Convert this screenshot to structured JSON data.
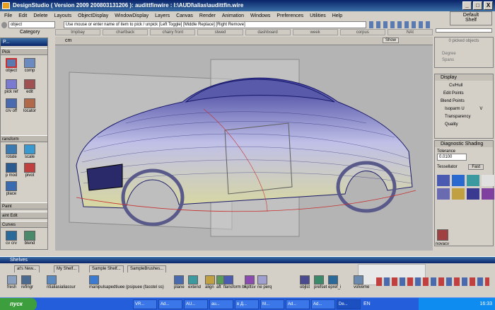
{
  "window": {
    "title": "DesignStudio ( Version 2009  200803131206 ): audittfinwire : I:\\AUDI\\alias\\audittfin.wire",
    "min": "_",
    "max": "□",
    "close": "X"
  },
  "menu": [
    "File",
    "Edit",
    "Delete",
    "Layouts",
    "ObjectDisplay",
    "WindowDisplay",
    "Layers",
    "Canvas",
    "Render",
    "Animation",
    "Windows",
    "Preferences",
    "Utilities",
    "Help"
  ],
  "toolbar": {
    "object_field": "object",
    "category_label": "Category",
    "prompt": "Use mouse or enter name of item to pick / unpick [Left Toggle] [Middle Replace] [Right Remove]"
  },
  "shelf_tabs_top": [
    "tmpbay",
    "chartback",
    "chairy front",
    "stwed",
    "dashboard",
    "week",
    "corpus",
    "NAt"
  ],
  "right_top": {
    "default": "Default",
    "shelf": "Shelf",
    "picked": "0 picked objects",
    "degree": "Degree",
    "spans": "Spans"
  },
  "viewbar": {
    "show": "Show",
    "view": "cm"
  },
  "palette": {
    "title": "P...",
    "pick_label": "Pick",
    "tools_pick": [
      {
        "icon": "object-pick-icon",
        "label": "object"
      },
      {
        "icon": "comp-pick-icon",
        "label": "comp"
      },
      {
        "icon": "pick-ref-icon",
        "label": "pick ref"
      },
      {
        "icon": "edit-icon",
        "label": "edit"
      },
      {
        "icon": "crv-off-icon",
        "label": "crv off"
      },
      {
        "icon": "locator-icon",
        "label": "locator"
      }
    ],
    "transform_label": "ransform",
    "tools_transform": [
      {
        "icon": "rotate-icon",
        "label": "rotate"
      },
      {
        "icon": "scale-icon",
        "label": "scale"
      },
      {
        "icon": "p-mod-icon",
        "label": "p mod"
      },
      {
        "icon": "pivot-icon",
        "label": "pivot"
      },
      {
        "icon": "place-icon",
        "label": "place"
      }
    ],
    "paint_label": "Paint",
    "paint_edit_label": "aint Edit",
    "curves_label": "Curves",
    "tools_curves": [
      {
        "icon": "cv-crv-icon",
        "label": "cv crv"
      },
      {
        "icon": "blend-icon",
        "label": "blend"
      }
    ]
  },
  "rpanel": {
    "display_title": "Display",
    "cvhull": "Cv/Hull",
    "edit_points": "Edit Points",
    "blend_points": "Blend Points",
    "isoparm": "Isoparm U",
    "isoparm_v": "V",
    "transparency": "Transparency",
    "quality": "Quality",
    "diag_title": "Diagnostic Shading",
    "tolerance": "Tolerance",
    "tolerance_value": "0.0100",
    "tessellator": "Tessellator",
    "tess_value": "Fast",
    "novacv": "novacv"
  },
  "shelves": {
    "title": "Shelves",
    "tabs": [
      "at's New...",
      "My Shelf...",
      "Sample Shelf...",
      "SampleBrushes..."
    ],
    "items": [
      "fresh",
      "refingr",
      "ntialiasialiassur",
      "manipulsapedtiuee (psipuee (fasstel ss)",
      "plane",
      "extend",
      "align",
      "aft",
      "flansform bl",
      "kpttsv",
      "ne perq",
      "objlst",
      "prefset",
      "epref_i",
      "volveme"
    ]
  },
  "taskbar": {
    "start": "пуск",
    "tasks": [
      "VR...",
      "Ad...",
      "AU...",
      "au...",
      "в Д...",
      "M...",
      "Ad...",
      "Ad...",
      "De..."
    ],
    "lang": "EN",
    "clock": "16:33"
  },
  "colors": {
    "titlebar": "#0a246a",
    "car_body": "#8a8ad0",
    "car_mesh": "#1a1a6a",
    "accent_red": "#c83030"
  }
}
